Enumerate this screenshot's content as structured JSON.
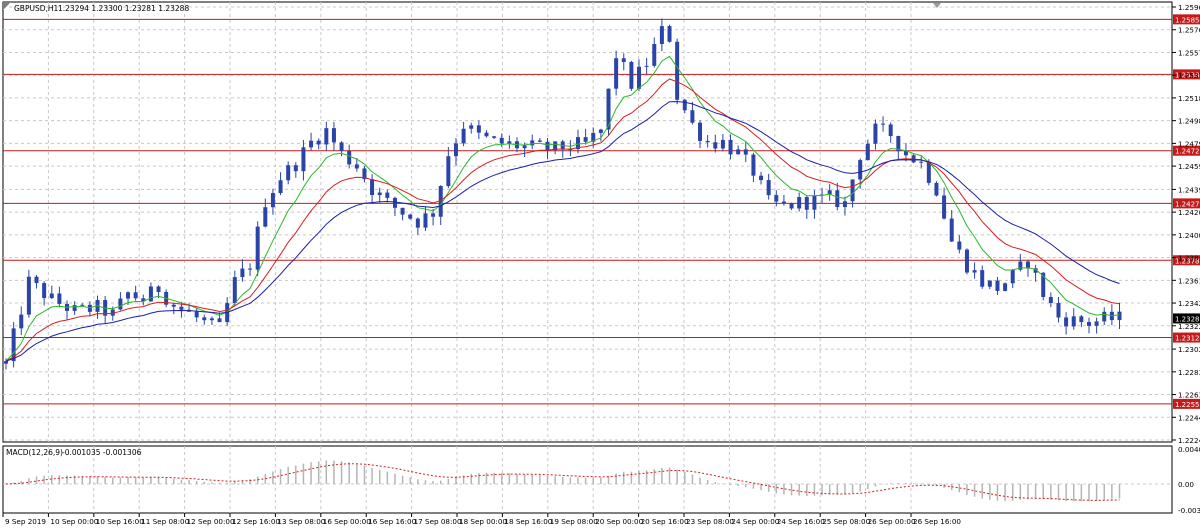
{
  "header": {
    "symbol_label": "GBPUSD,H1",
    "ohlc_text": "1.23294 1.23300 1.23281 1.23288"
  },
  "indicator": {
    "label": "MACD(12,26,9)",
    "values_text": "-0.001035 -0.001306"
  },
  "colors": {
    "candle": "#2a44a8",
    "ma_fast": "#2db82d",
    "ma_mid": "#d81f1f",
    "ma_slow": "#1c1fa6",
    "level_line": "#c41a1a",
    "level_tag": "#c41a1a",
    "price_tag": "#000000",
    "grid": "#c8c8c8",
    "macd_hist": "#b5b5b5",
    "macd_signal": "#d81f1f"
  },
  "chart_data": {
    "type": "candlestick",
    "y_axis_ticks": [
      "1.25960",
      "1.25765",
      "1.25570",
      "1.25375",
      "1.25180",
      "1.24985",
      "1.24790",
      "1.24595",
      "1.24395",
      "1.24200",
      "1.24005",
      "1.23810",
      "1.23615",
      "1.23420",
      "1.23225",
      "1.23025",
      "1.22830",
      "1.22635",
      "1.22440",
      "1.22245"
    ],
    "ylim": [
      1.22245,
      1.2596
    ],
    "x_axis_ticks": [
      "9 Sep 2019",
      "10 Sep 00:00",
      "10 Sep 16:00",
      "11 Sep 08:00",
      "12 Sep 00:00",
      "12 Sep 16:00",
      "13 Sep 08:00",
      "16 Sep 00:00",
      "16 Sep 16:00",
      "17 Sep 08:00",
      "18 Sep 00:00",
      "18 Sep 16:00",
      "19 Sep 08:00",
      "20 Sep 00:00",
      "20 Sep 16:00",
      "23 Sep 08:00",
      "24 Sep 00:00",
      "24 Sep 16:00",
      "25 Sep 08:00",
      "26 Sep 00:00",
      "26 Sep 16:00"
    ],
    "horizontal_levels": [
      "1.25854",
      "1.25382",
      "1.24727",
      "1.24275",
      "1.23787",
      "1.23124",
      "1.22555"
    ],
    "current_price_label": "1.23288",
    "price_path": [
      [
        0,
        1.229
      ],
      [
        3,
        1.236
      ],
      [
        6,
        1.2345
      ],
      [
        9,
        1.2335
      ],
      [
        12,
        1.2338
      ],
      [
        14,
        1.2332
      ],
      [
        16,
        1.235
      ],
      [
        18,
        1.2345
      ],
      [
        20,
        1.2355
      ],
      [
        22,
        1.234
      ],
      [
        24,
        1.2333
      ],
      [
        26,
        1.2325
      ],
      [
        28,
        1.232
      ],
      [
        30,
        1.236
      ],
      [
        32,
        1.2375
      ],
      [
        34,
        1.243
      ],
      [
        36,
        1.245
      ],
      [
        38,
        1.2462
      ],
      [
        40,
        1.248
      ],
      [
        42,
        1.249
      ],
      [
        44,
        1.247
      ],
      [
        46,
        1.246
      ],
      [
        48,
        1.244
      ],
      [
        50,
        1.2428
      ],
      [
        52,
        1.242
      ],
      [
        54,
        1.2412
      ],
      [
        56,
        1.242
      ],
      [
        58,
        1.247
      ],
      [
        60,
        1.2495
      ],
      [
        62,
        1.2485
      ],
      [
        64,
        1.248
      ],
      [
        66,
        1.2478
      ],
      [
        68,
        1.2476
      ],
      [
        70,
        1.2475
      ],
      [
        72,
        1.2474
      ],
      [
        74,
        1.2477
      ],
      [
        76,
        1.2478
      ],
      [
        78,
        1.249
      ],
      [
        80,
        1.2555
      ],
      [
        82,
        1.253
      ],
      [
        84,
        1.2548
      ],
      [
        86,
        1.2575
      ],
      [
        87,
        1.257
      ],
      [
        88,
        1.252
      ],
      [
        90,
        1.2495
      ],
      [
        92,
        1.248
      ],
      [
        94,
        1.248
      ],
      [
        96,
        1.247
      ],
      [
        98,
        1.2455
      ],
      [
        100,
        1.2428
      ],
      [
        102,
        1.2425
      ],
      [
        104,
        1.2428
      ],
      [
        106,
        1.243
      ],
      [
        108,
        1.2432
      ],
      [
        110,
        1.2427
      ],
      [
        112,
        1.247
      ],
      [
        114,
        1.249
      ],
      [
        116,
        1.2487
      ],
      [
        118,
        1.247
      ],
      [
        120,
        1.2462
      ],
      [
        122,
        1.244
      ],
      [
        124,
        1.2395
      ],
      [
        126,
        1.2375
      ],
      [
        128,
        1.236
      ],
      [
        130,
        1.2355
      ],
      [
        132,
        1.2365
      ],
      [
        134,
        1.2378
      ],
      [
        136,
        1.235
      ],
      [
        138,
        1.233
      ],
      [
        140,
        1.2327
      ],
      [
        142,
        1.2325
      ],
      [
        144,
        1.2328
      ],
      [
        146,
        1.23288
      ]
    ],
    "moving_averages": [
      "fast (green)",
      "mid (red)",
      "slow (blue)"
    ]
  }
}
